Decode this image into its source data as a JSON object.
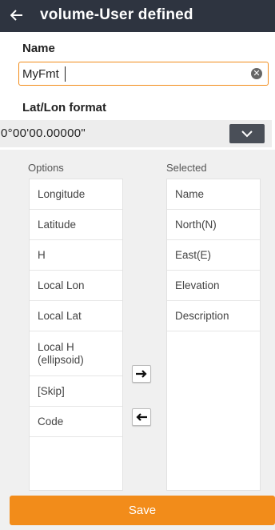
{
  "header": {
    "back_icon": "arrow-left-icon",
    "title": "volume-User defined"
  },
  "name": {
    "label": "Name",
    "value": "MyFmt",
    "clear_icon": "clear-circle-icon"
  },
  "latlon": {
    "label": "Lat/Lon format",
    "selected": "0°00'00.00000\"",
    "dropdown_icon": "chevron-down-icon"
  },
  "options": {
    "header": "Options",
    "items": [
      "Longitude",
      "Latitude",
      "H",
      "Local Lon",
      "Local Lat",
      "Local H\n(ellipsoid)",
      "[Skip]",
      "Code"
    ]
  },
  "selected": {
    "header": "Selected",
    "items": [
      "Name",
      "North(N)",
      "East(E)",
      "Elevation",
      "Description"
    ]
  },
  "transfer": {
    "add_icon": "arrow-right-icon",
    "remove_icon": "arrow-left-icon"
  },
  "footer": {
    "save_label": "Save"
  },
  "colors": {
    "appbar": "#2e3440",
    "accent": "#f28c1a"
  }
}
